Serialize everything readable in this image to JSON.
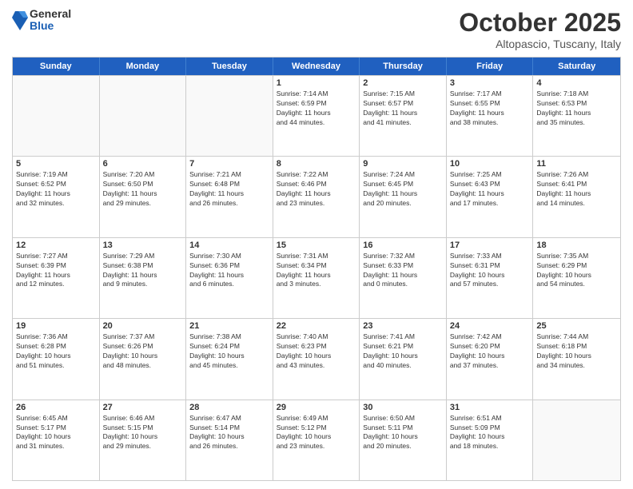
{
  "header": {
    "logo_general": "General",
    "logo_blue": "Blue",
    "month_title": "October 2025",
    "location": "Altopascio, Tuscany, Italy"
  },
  "calendar": {
    "days_of_week": [
      "Sunday",
      "Monday",
      "Tuesday",
      "Wednesday",
      "Thursday",
      "Friday",
      "Saturday"
    ],
    "rows": [
      [
        {
          "day": "",
          "empty": true
        },
        {
          "day": "",
          "empty": true
        },
        {
          "day": "",
          "empty": true
        },
        {
          "day": "1",
          "lines": [
            "Sunrise: 7:14 AM",
            "Sunset: 6:59 PM",
            "Daylight: 11 hours",
            "and 44 minutes."
          ]
        },
        {
          "day": "2",
          "lines": [
            "Sunrise: 7:15 AM",
            "Sunset: 6:57 PM",
            "Daylight: 11 hours",
            "and 41 minutes."
          ]
        },
        {
          "day": "3",
          "lines": [
            "Sunrise: 7:17 AM",
            "Sunset: 6:55 PM",
            "Daylight: 11 hours",
            "and 38 minutes."
          ]
        },
        {
          "day": "4",
          "lines": [
            "Sunrise: 7:18 AM",
            "Sunset: 6:53 PM",
            "Daylight: 11 hours",
            "and 35 minutes."
          ]
        }
      ],
      [
        {
          "day": "5",
          "lines": [
            "Sunrise: 7:19 AM",
            "Sunset: 6:52 PM",
            "Daylight: 11 hours",
            "and 32 minutes."
          ]
        },
        {
          "day": "6",
          "lines": [
            "Sunrise: 7:20 AM",
            "Sunset: 6:50 PM",
            "Daylight: 11 hours",
            "and 29 minutes."
          ]
        },
        {
          "day": "7",
          "lines": [
            "Sunrise: 7:21 AM",
            "Sunset: 6:48 PM",
            "Daylight: 11 hours",
            "and 26 minutes."
          ]
        },
        {
          "day": "8",
          "lines": [
            "Sunrise: 7:22 AM",
            "Sunset: 6:46 PM",
            "Daylight: 11 hours",
            "and 23 minutes."
          ]
        },
        {
          "day": "9",
          "lines": [
            "Sunrise: 7:24 AM",
            "Sunset: 6:45 PM",
            "Daylight: 11 hours",
            "and 20 minutes."
          ]
        },
        {
          "day": "10",
          "lines": [
            "Sunrise: 7:25 AM",
            "Sunset: 6:43 PM",
            "Daylight: 11 hours",
            "and 17 minutes."
          ]
        },
        {
          "day": "11",
          "lines": [
            "Sunrise: 7:26 AM",
            "Sunset: 6:41 PM",
            "Daylight: 11 hours",
            "and 14 minutes."
          ]
        }
      ],
      [
        {
          "day": "12",
          "lines": [
            "Sunrise: 7:27 AM",
            "Sunset: 6:39 PM",
            "Daylight: 11 hours",
            "and 12 minutes."
          ]
        },
        {
          "day": "13",
          "lines": [
            "Sunrise: 7:29 AM",
            "Sunset: 6:38 PM",
            "Daylight: 11 hours",
            "and 9 minutes."
          ]
        },
        {
          "day": "14",
          "lines": [
            "Sunrise: 7:30 AM",
            "Sunset: 6:36 PM",
            "Daylight: 11 hours",
            "and 6 minutes."
          ]
        },
        {
          "day": "15",
          "lines": [
            "Sunrise: 7:31 AM",
            "Sunset: 6:34 PM",
            "Daylight: 11 hours",
            "and 3 minutes."
          ]
        },
        {
          "day": "16",
          "lines": [
            "Sunrise: 7:32 AM",
            "Sunset: 6:33 PM",
            "Daylight: 11 hours",
            "and 0 minutes."
          ]
        },
        {
          "day": "17",
          "lines": [
            "Sunrise: 7:33 AM",
            "Sunset: 6:31 PM",
            "Daylight: 10 hours",
            "and 57 minutes."
          ]
        },
        {
          "day": "18",
          "lines": [
            "Sunrise: 7:35 AM",
            "Sunset: 6:29 PM",
            "Daylight: 10 hours",
            "and 54 minutes."
          ]
        }
      ],
      [
        {
          "day": "19",
          "lines": [
            "Sunrise: 7:36 AM",
            "Sunset: 6:28 PM",
            "Daylight: 10 hours",
            "and 51 minutes."
          ]
        },
        {
          "day": "20",
          "lines": [
            "Sunrise: 7:37 AM",
            "Sunset: 6:26 PM",
            "Daylight: 10 hours",
            "and 48 minutes."
          ]
        },
        {
          "day": "21",
          "lines": [
            "Sunrise: 7:38 AM",
            "Sunset: 6:24 PM",
            "Daylight: 10 hours",
            "and 45 minutes."
          ]
        },
        {
          "day": "22",
          "lines": [
            "Sunrise: 7:40 AM",
            "Sunset: 6:23 PM",
            "Daylight: 10 hours",
            "and 43 minutes."
          ]
        },
        {
          "day": "23",
          "lines": [
            "Sunrise: 7:41 AM",
            "Sunset: 6:21 PM",
            "Daylight: 10 hours",
            "and 40 minutes."
          ]
        },
        {
          "day": "24",
          "lines": [
            "Sunrise: 7:42 AM",
            "Sunset: 6:20 PM",
            "Daylight: 10 hours",
            "and 37 minutes."
          ]
        },
        {
          "day": "25",
          "lines": [
            "Sunrise: 7:44 AM",
            "Sunset: 6:18 PM",
            "Daylight: 10 hours",
            "and 34 minutes."
          ]
        }
      ],
      [
        {
          "day": "26",
          "lines": [
            "Sunrise: 6:45 AM",
            "Sunset: 5:17 PM",
            "Daylight: 10 hours",
            "and 31 minutes."
          ]
        },
        {
          "day": "27",
          "lines": [
            "Sunrise: 6:46 AM",
            "Sunset: 5:15 PM",
            "Daylight: 10 hours",
            "and 29 minutes."
          ]
        },
        {
          "day": "28",
          "lines": [
            "Sunrise: 6:47 AM",
            "Sunset: 5:14 PM",
            "Daylight: 10 hours",
            "and 26 minutes."
          ]
        },
        {
          "day": "29",
          "lines": [
            "Sunrise: 6:49 AM",
            "Sunset: 5:12 PM",
            "Daylight: 10 hours",
            "and 23 minutes."
          ]
        },
        {
          "day": "30",
          "lines": [
            "Sunrise: 6:50 AM",
            "Sunset: 5:11 PM",
            "Daylight: 10 hours",
            "and 20 minutes."
          ]
        },
        {
          "day": "31",
          "lines": [
            "Sunrise: 6:51 AM",
            "Sunset: 5:09 PM",
            "Daylight: 10 hours",
            "and 18 minutes."
          ]
        },
        {
          "day": "",
          "empty": true
        }
      ]
    ]
  }
}
